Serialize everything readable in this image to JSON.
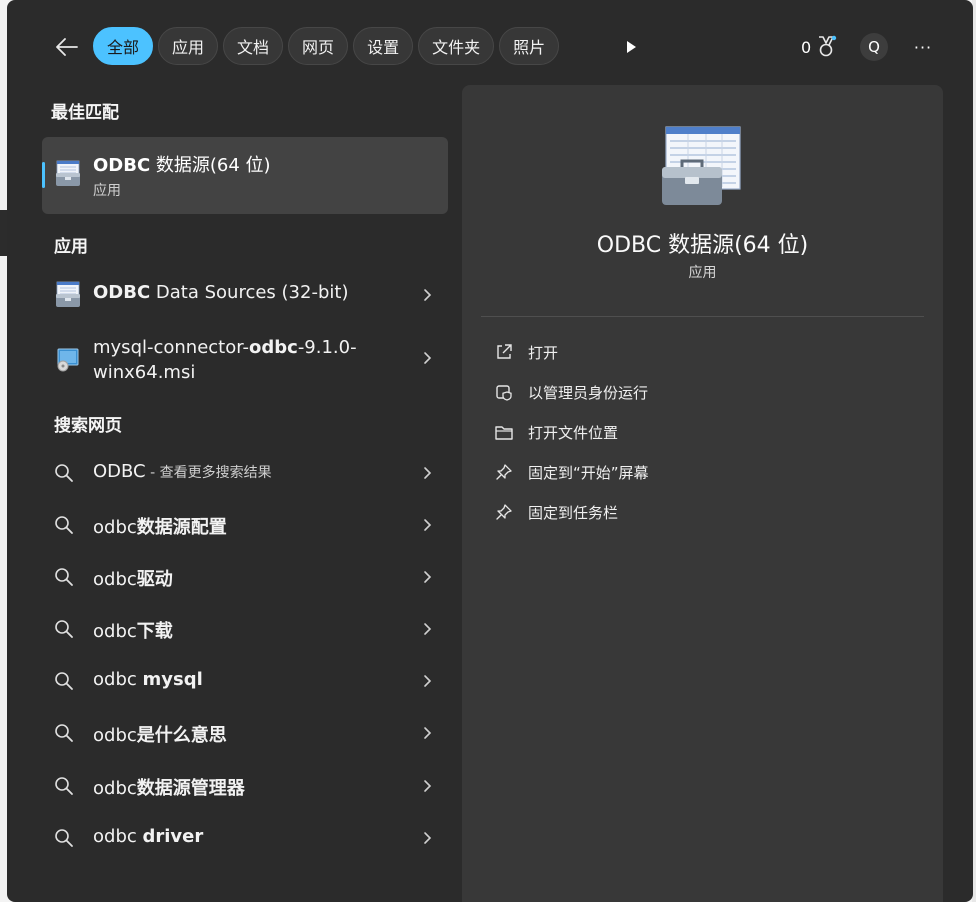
{
  "topbar": {
    "tabs": [
      "全部",
      "应用",
      "文档",
      "网页",
      "设置",
      "文件夹",
      "照片"
    ],
    "points": "0",
    "avatar_letter": "Q",
    "more": "···"
  },
  "sections": {
    "best_match": "最佳匹配",
    "apps": "应用",
    "web_search": "搜索网页"
  },
  "best_match": {
    "name_bold": "ODBC",
    "name_rest": " 数据源(64 位)",
    "kind": "应用"
  },
  "apps": [
    {
      "bold": "ODBC",
      "rest": " Data Sources (32-bit)"
    },
    {
      "pre": "mysql-connector-",
      "bold": "odbc",
      "post": "-9.1.0-",
      "line2": "winx64.msi"
    }
  ],
  "web": [
    {
      "normal": "ODBC",
      "hint": " - 查看更多搜索结果"
    },
    {
      "normal": "odbc",
      "bold": "数据源配置"
    },
    {
      "normal": "odbc",
      "bold": "驱动"
    },
    {
      "normal": "odbc",
      "bold": "下载"
    },
    {
      "normal": "odbc ",
      "bold": "mysql"
    },
    {
      "normal": "odbc",
      "bold": "是什么意思"
    },
    {
      "normal": "odbc",
      "bold": "数据源管理器"
    },
    {
      "normal": "odbc ",
      "bold": "driver"
    }
  ],
  "detail": {
    "title": "ODBC 数据源(64 位)",
    "kind": "应用",
    "actions": [
      "打开",
      "以管理员身份运行",
      "打开文件位置",
      "固定到“开始”屏幕",
      "固定到任务栏"
    ]
  },
  "colors": {
    "accent": "#4cc2ff",
    "panel": "#2b2b2b",
    "detail_panel": "#383838"
  },
  "icons": [
    "back-arrow-icon",
    "play-icon",
    "rewards-medal-icon",
    "more-icon",
    "search-icon",
    "chevron-right-icon",
    "open-external-icon",
    "admin-shield-icon",
    "folder-icon",
    "pin-icon",
    "odbc-toolbox-icon",
    "msi-installer-icon"
  ]
}
